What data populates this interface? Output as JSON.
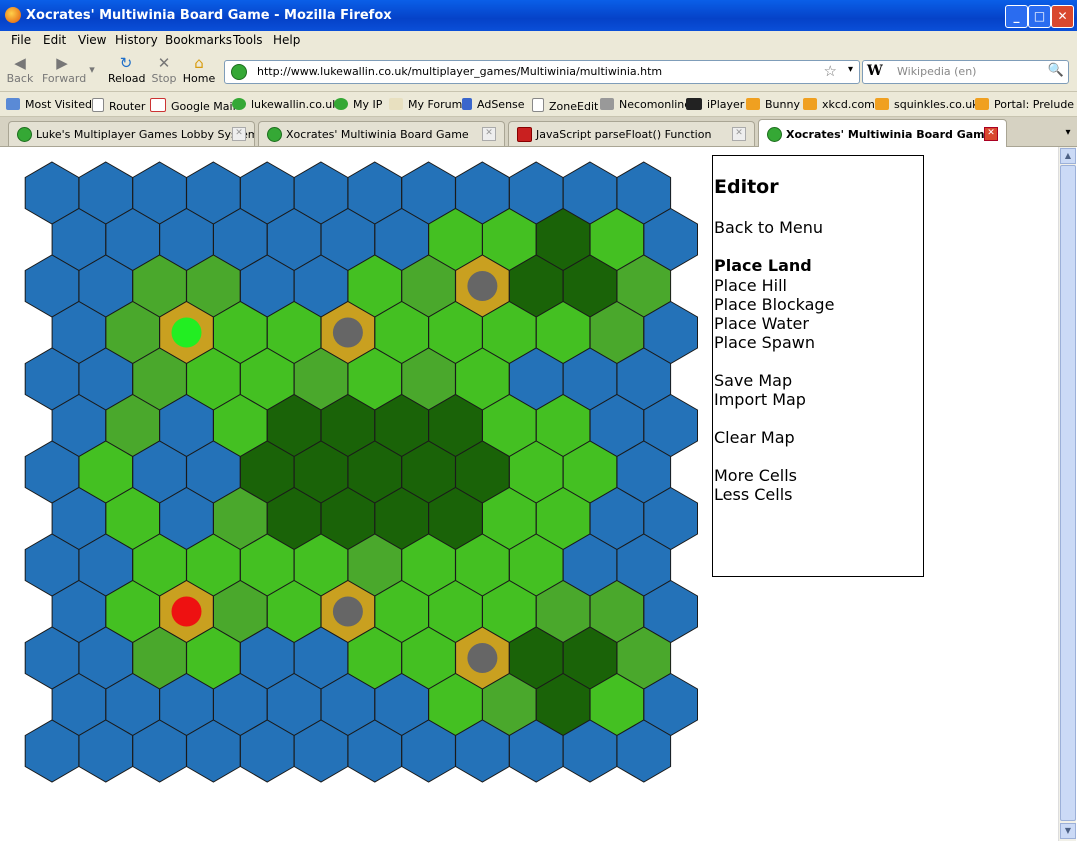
{
  "window": {
    "title": "Xocrates' Multiwinia Board Game - Mozilla Firefox",
    "min": "_",
    "max": "□",
    "close": "✕"
  },
  "menu": [
    "File",
    "Edit",
    "View",
    "History",
    "Bookmarks",
    "Tools",
    "Help"
  ],
  "nav": {
    "back": "Back",
    "forward": "Forward",
    "reload": "Reload",
    "stop": "Stop",
    "home": "Home"
  },
  "address": {
    "url": "http://www.lukewallin.co.uk/multiplayer_games/Multiwinia/multiwinia.htm"
  },
  "search": {
    "engine": "W",
    "placeholder": "Wikipedia (en)"
  },
  "bookmarks": [
    "Most Visited",
    "Router",
    "Google Mail",
    "lukewallin.co.uk",
    "My IP",
    "My Forum",
    "AdSense",
    "ZoneEdit",
    "Necomonline",
    "iPlayer",
    "Bunny",
    "xkcd.com",
    "squinkles.co.uk",
    "Portal: Prelude"
  ],
  "tabs": [
    {
      "label": "Luke's Multiplayer Games Lobby System",
      "active": false
    },
    {
      "label": "Xocrates' Multiwinia Board Game",
      "active": false
    },
    {
      "label": "JavaScript parseFloat() Function",
      "active": false
    },
    {
      "label": "Xocrates' Multiwinia Board Game",
      "active": true
    }
  ],
  "editor": {
    "title": "Editor",
    "back": "Back to Menu",
    "place_land": "Place Land",
    "place_hill": "Place Hill",
    "place_blockage": "Place Blockage",
    "place_water": "Place Water",
    "place_spawn": "Place Spawn",
    "save_map": "Save Map",
    "import_map": "Import Map",
    "clear_map": "Clear Map",
    "more_cells": "More Cells",
    "less_cells": "Less Cells"
  },
  "colors": {
    "water": "#2472b8",
    "land_light": "#44c022",
    "land_mid": "#4aa82c",
    "blockage": "#1a6308",
    "hill": "#c9a020",
    "marker": "#666666",
    "spawn_green": "#22ee22",
    "spawn_red": "#ee1111"
  },
  "board": {
    "legend": "W=water L=light land M=mid land B=blockage H=hill G=green spawn R=red spawn",
    "rows": [
      "WWWWWWWWWWWW",
      "WWWWWWWLLBLW",
      "WWMMWWLMHBBM",
      "WMGLLHLLLLMW",
      "WWMLLMLMLWWW",
      "WMWLBBBBLLWW",
      "WLWWBBBBBLLW",
      "WLWMBBBBLLWW",
      "WWLLLLMLLLWW",
      "WLRMLHLLLMMW",
      "WWMLWWLLHBBM",
      "WWWWWWWLMBLW",
      "WWWWWWWWWWWW"
    ]
  }
}
